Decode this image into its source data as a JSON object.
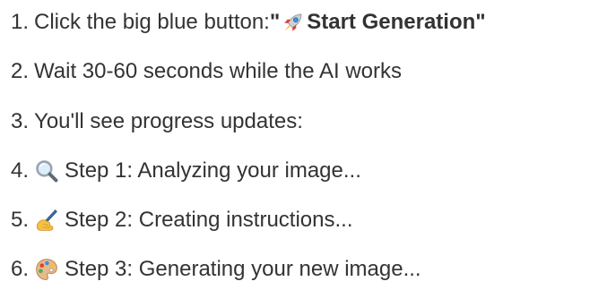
{
  "steps": [
    {
      "number": "1.",
      "text": "Click the big blue button: ",
      "quote_open": "\"",
      "button_label": "Start Generation",
      "quote_close": "\"",
      "icon": "rocket-icon"
    },
    {
      "number": "2.",
      "text": "Wait 30-60 seconds while the AI works"
    },
    {
      "number": "3.",
      "text": "You'll see progress updates:"
    },
    {
      "number": "4.",
      "text": "Step 1: Analyzing your image...",
      "icon": "magnifying-glass-icon"
    },
    {
      "number": "5.",
      "text": "Step 2: Creating instructions...",
      "icon": "writing-hand-icon"
    },
    {
      "number": "6.",
      "text": "Step 3: Generating your new image...",
      "icon": "artist-palette-icon"
    }
  ]
}
